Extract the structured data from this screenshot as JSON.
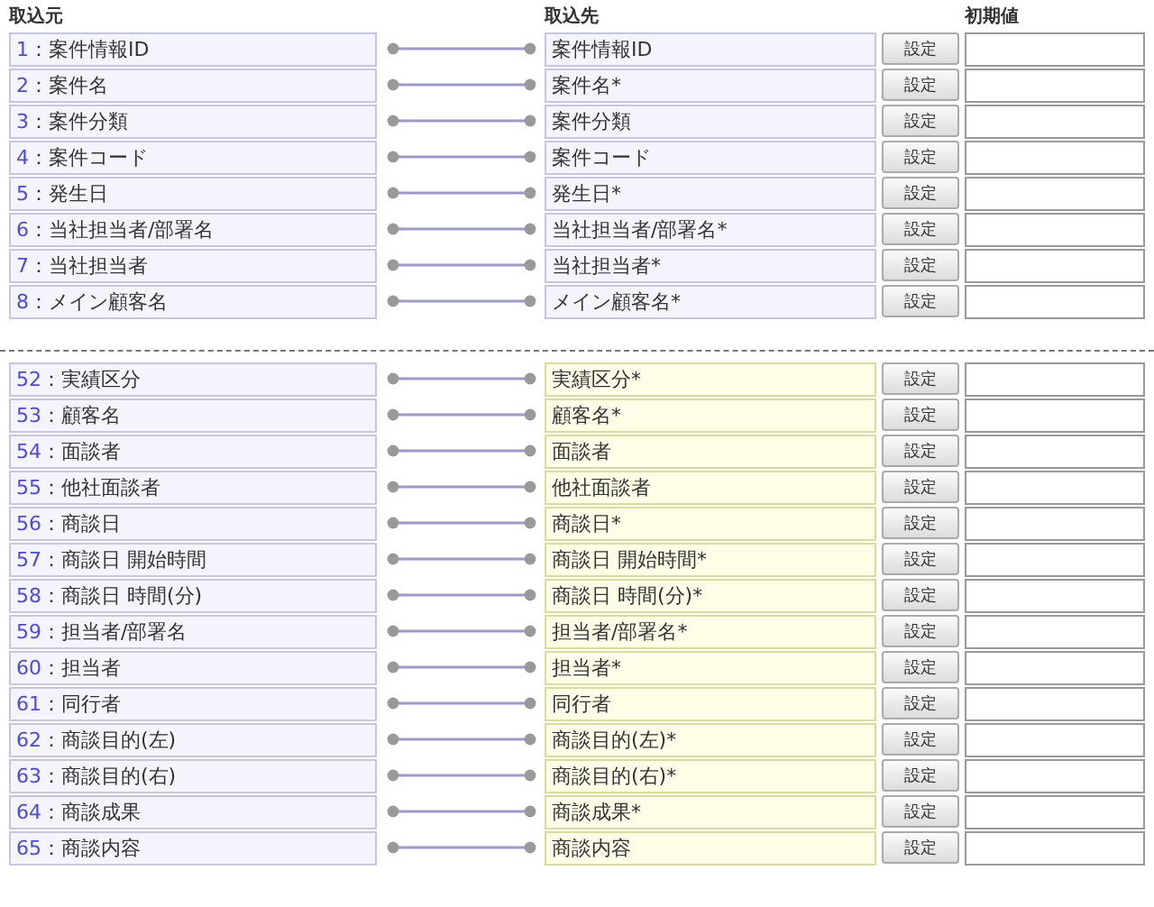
{
  "headers": {
    "source": "取込元",
    "target": "取込先",
    "initial": "初期値"
  },
  "separator": "：",
  "groups": [
    {
      "highlighted": false,
      "rows": [
        {
          "number": "1",
          "source": "案件情報ID",
          "target": "案件情報ID",
          "button": "設定"
        },
        {
          "number": "2",
          "source": "案件名",
          "target": "案件名*",
          "button": "設定"
        },
        {
          "number": "3",
          "source": "案件分類",
          "target": "案件分類",
          "button": "設定"
        },
        {
          "number": "4",
          "source": "案件コード",
          "target": "案件コード",
          "button": "設定"
        },
        {
          "number": "5",
          "source": "発生日",
          "target": "発生日*",
          "button": "設定"
        },
        {
          "number": "6",
          "source": "当社担当者/部署名",
          "target": "当社担当者/部署名*",
          "button": "設定"
        },
        {
          "number": "7",
          "source": "当社担当者",
          "target": "当社担当者*",
          "button": "設定"
        },
        {
          "number": "8",
          "source": "メイン顧客名",
          "target": "メイン顧客名*",
          "button": "設定"
        }
      ]
    },
    {
      "highlighted": true,
      "rows": [
        {
          "number": "52",
          "source": "実績区分",
          "target": "実績区分*",
          "button": "設定"
        },
        {
          "number": "53",
          "source": "顧客名",
          "target": "顧客名*",
          "button": "設定"
        },
        {
          "number": "54",
          "source": "面談者",
          "target": "面談者",
          "button": "設定"
        },
        {
          "number": "55",
          "source": "他社面談者",
          "target": "他社面談者",
          "button": "設定"
        },
        {
          "number": "56",
          "source": "商談日",
          "target": "商談日*",
          "button": "設定"
        },
        {
          "number": "57",
          "source": "商談日 開始時間",
          "target": "商談日 開始時間*",
          "button": "設定"
        },
        {
          "number": "58",
          "source": "商談日 時間(分)",
          "target": "商談日 時間(分)*",
          "button": "設定"
        },
        {
          "number": "59",
          "source": "担当者/部署名",
          "target": "担当者/部署名*",
          "button": "設定"
        },
        {
          "number": "60",
          "source": "担当者",
          "target": "担当者*",
          "button": "設定"
        },
        {
          "number": "61",
          "source": "同行者",
          "target": "同行者",
          "button": "設定"
        },
        {
          "number": "62",
          "source": "商談目的(左)",
          "target": "商談目的(左)*",
          "button": "設定"
        },
        {
          "number": "63",
          "source": "商談目的(右)",
          "target": "商談目的(右)*",
          "button": "設定"
        },
        {
          "number": "64",
          "source": "商談成果",
          "target": "商談成果*",
          "button": "設定"
        },
        {
          "number": "65",
          "source": "商談内容",
          "target": "商談内容",
          "button": "設定"
        }
      ]
    }
  ]
}
